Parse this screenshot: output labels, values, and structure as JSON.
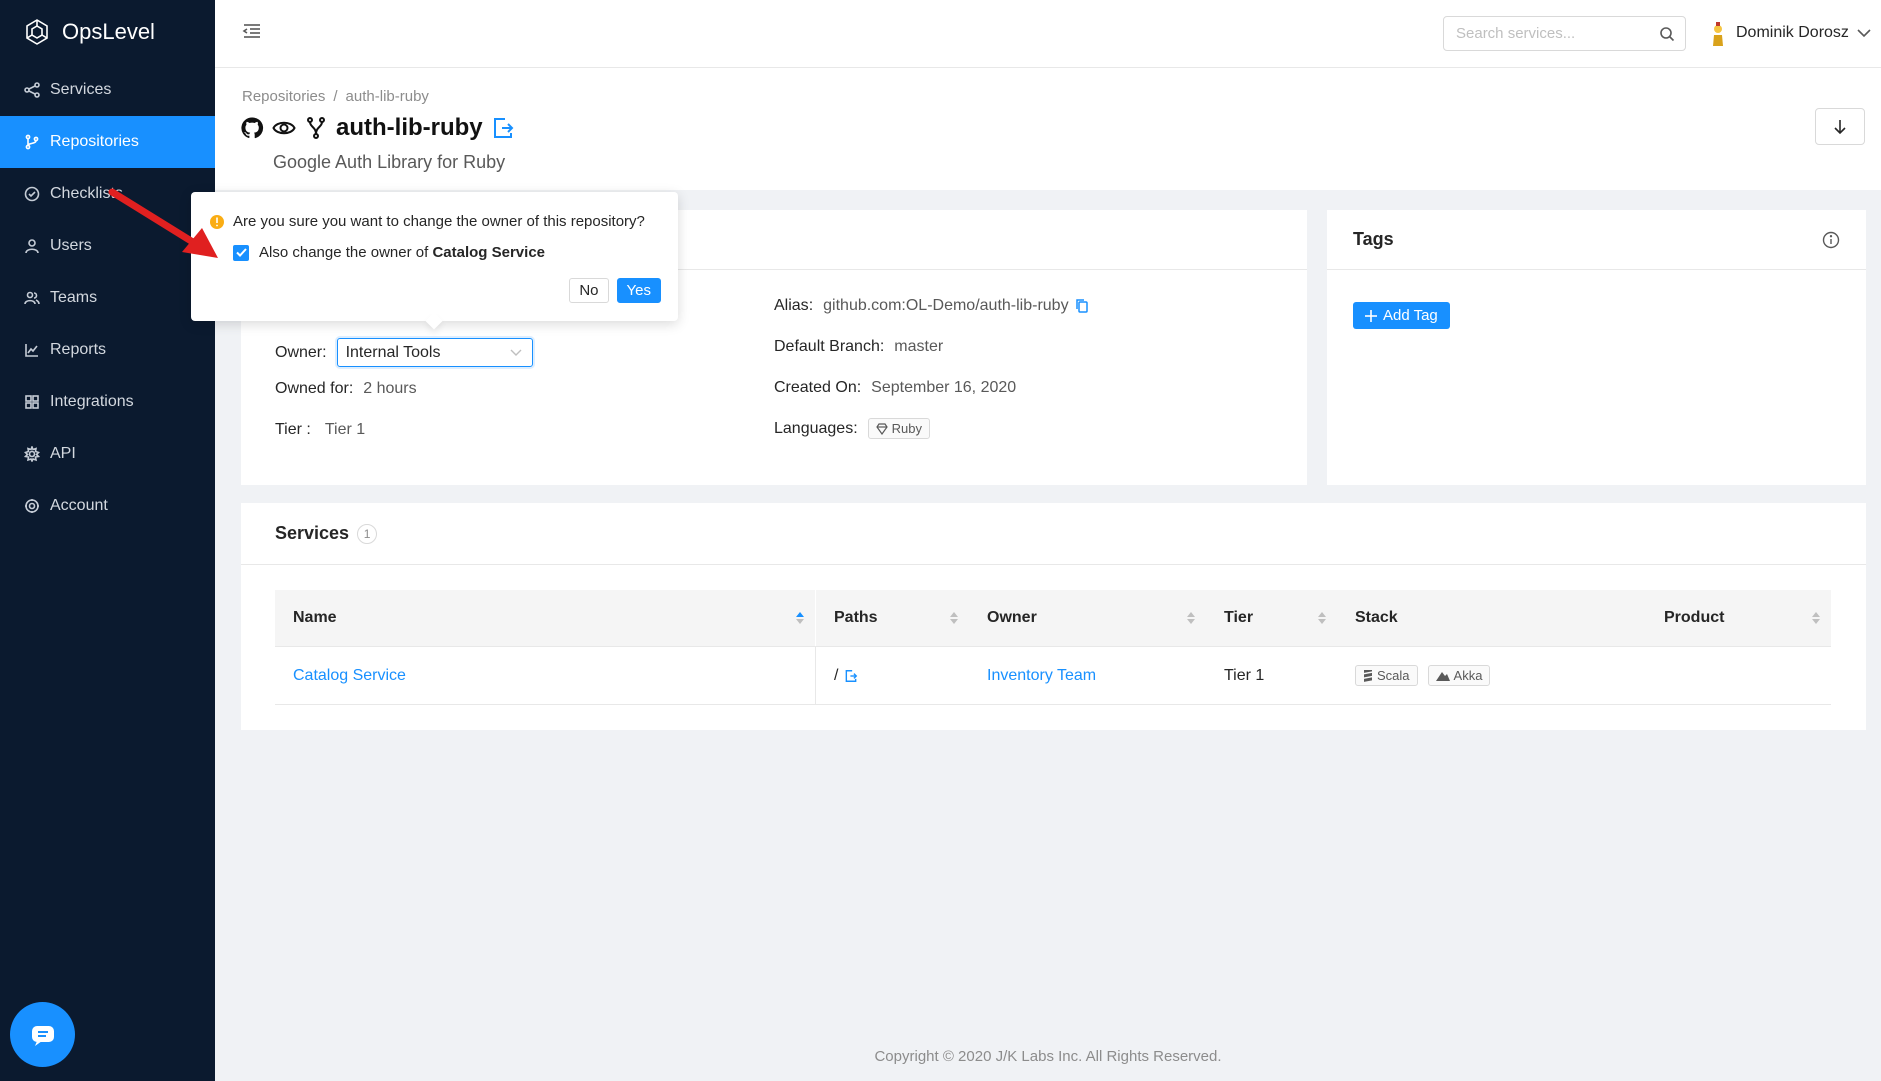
{
  "app": {
    "name": "OpsLevel"
  },
  "sidebar": {
    "items": [
      {
        "label": "Services",
        "icon": "share-icon"
      },
      {
        "label": "Repositories",
        "icon": "branch-icon",
        "active": true
      },
      {
        "label": "Checklists",
        "icon": "check-circle-icon"
      },
      {
        "label": "Users",
        "icon": "user-icon"
      },
      {
        "label": "Teams",
        "icon": "team-icon"
      },
      {
        "label": "Reports",
        "icon": "chart-icon"
      },
      {
        "label": "Integrations",
        "icon": "grid-icon"
      },
      {
        "label": "API",
        "icon": "api-icon"
      },
      {
        "label": "Account",
        "icon": "gear-icon"
      }
    ]
  },
  "header": {
    "search_placeholder": "Search services...",
    "user_name": "Dominik Dorosz"
  },
  "page": {
    "breadcrumb": [
      "Repositories",
      "auth-lib-ruby"
    ],
    "title": "auth-lib-ruby",
    "subtitle": "Google Auth Library for Ruby"
  },
  "details": {
    "owner_label": "Owner",
    "owner_value": "Internal Tools",
    "owned_for_label": "Owned for",
    "owned_for_value": "2 hours",
    "tier_label": "Tier",
    "tier_value": "Tier 1",
    "alias_label": "Alias",
    "alias_value": "github.com:OL-Demo/auth-lib-ruby",
    "branch_label": "Default Branch",
    "branch_value": "master",
    "created_label": "Created On",
    "created_value": "September 16, 2020",
    "languages_label": "Languages",
    "languages": [
      "Ruby"
    ]
  },
  "tags": {
    "title": "Tags",
    "add_label": "Add Tag"
  },
  "services": {
    "title": "Services",
    "count": "1",
    "columns": [
      "Name",
      "Paths",
      "Owner",
      "Tier",
      "Stack",
      "Product"
    ],
    "rows": [
      {
        "name": "Catalog Service",
        "path": "/",
        "owner": "Inventory Team",
        "tier": "Tier 1",
        "stack": [
          "Scala",
          "Akka"
        ],
        "product": ""
      }
    ]
  },
  "popconfirm": {
    "message": "Are you sure you want to change the owner of this repository?",
    "checkbox_prefix": "Also change the owner of",
    "checkbox_target": "Catalog Service",
    "checked": true,
    "no_label": "No",
    "yes_label": "Yes"
  },
  "footer": {
    "text": "Copyright © 2020 J/K Labs Inc. All Rights Reserved."
  },
  "colors": {
    "sidebar_bg": "#0b1a2f",
    "accent": "#1890ff",
    "warning": "#faad14",
    "annotation": "#e02020"
  }
}
